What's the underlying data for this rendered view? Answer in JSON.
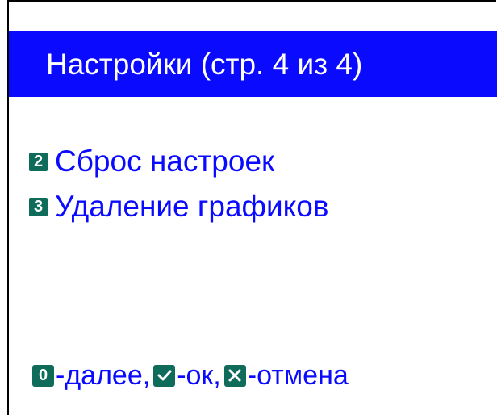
{
  "header": {
    "title": "Настройки (стр. 4 из 4)"
  },
  "menu": {
    "items": [
      {
        "key": "2",
        "label": "Сброс настроек"
      },
      {
        "key": "3",
        "label": "Удаление графиков"
      }
    ]
  },
  "footer": {
    "next_key": "0",
    "next_label": "-далее,",
    "ok_icon": "check-icon",
    "ok_label": "-ок,",
    "cancel_icon": "cross-icon",
    "cancel_label": "-отмена"
  },
  "colors": {
    "title_bar": "#0a0aff",
    "text": "#0a0aff",
    "badge": "#0f6b5a"
  }
}
